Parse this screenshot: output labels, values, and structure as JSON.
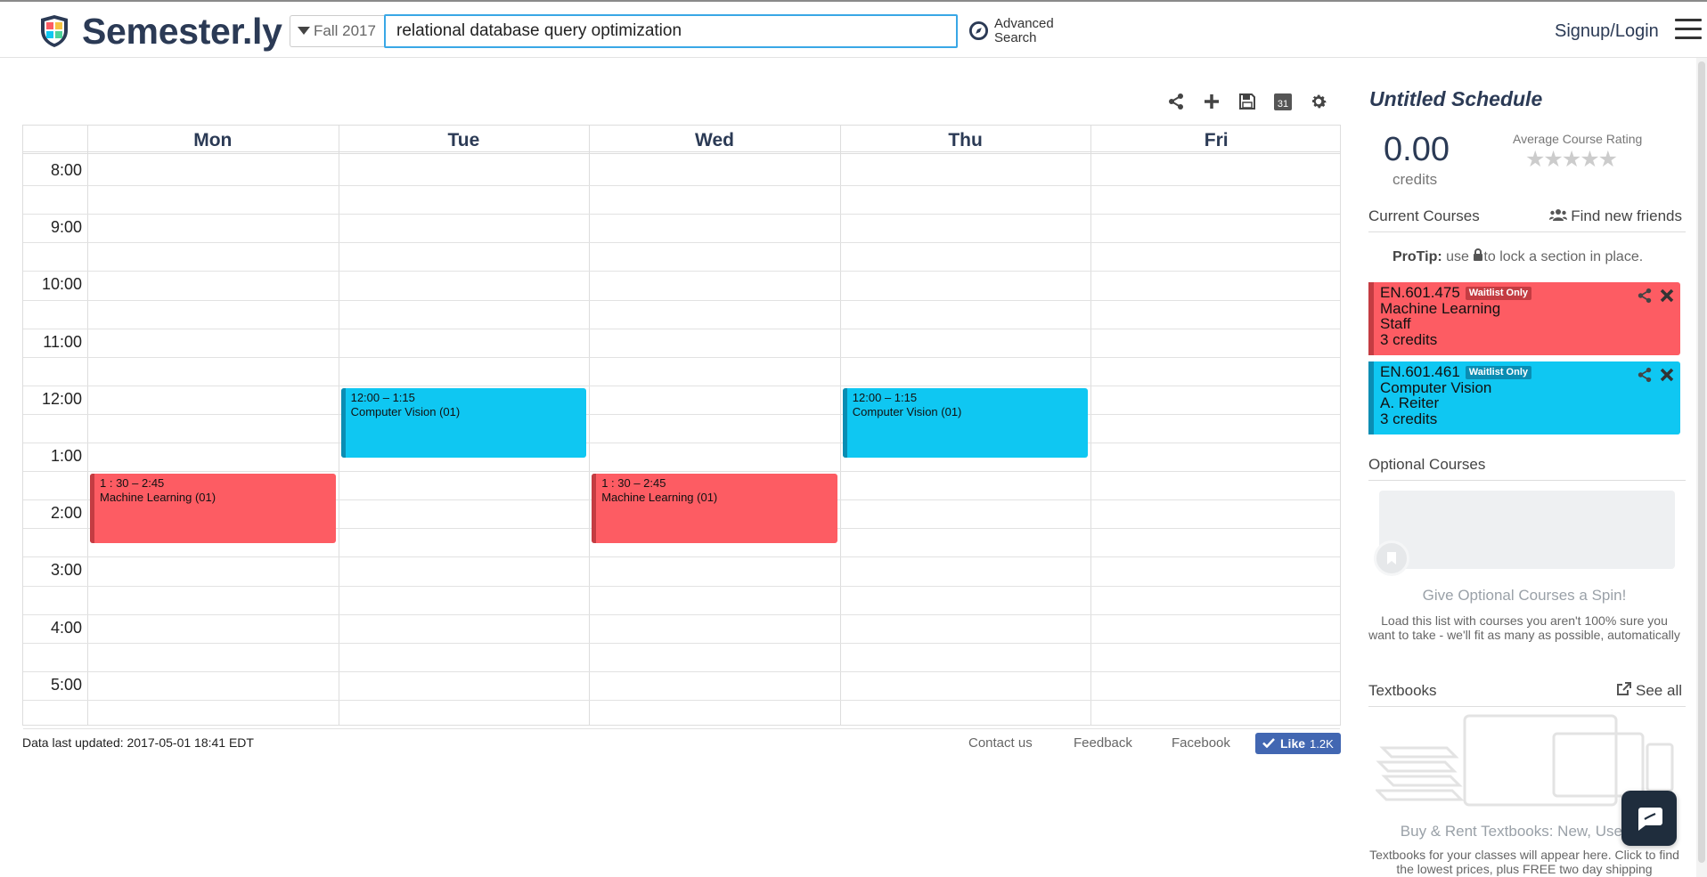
{
  "header": {
    "brand": "Semester.ly",
    "semester": "Fall 2017",
    "search_value": "relational database query optimization",
    "advanced_search_line1": "Advanced",
    "advanced_search_line2": "Search",
    "signup_login": "Signup/Login"
  },
  "toolbar": {
    "icons": [
      "share-icon",
      "plus-icon",
      "save-icon",
      "calendar-icon",
      "gear-icon"
    ],
    "calendar_badge": "31"
  },
  "calendar": {
    "days": [
      "Mon",
      "Tue",
      "Wed",
      "Thu",
      "Fri"
    ],
    "times": [
      "8:00",
      "9:00",
      "10:00",
      "11:00",
      "12:00",
      "1:00",
      "2:00",
      "3:00",
      "4:00",
      "5:00"
    ],
    "events": [
      {
        "day": 0,
        "start": 13.5,
        "end": 14.75,
        "time": "1 : 30 – 2:45",
        "title": "Machine Learning (01)",
        "color": "red"
      },
      {
        "day": 1,
        "start": 12.0,
        "end": 13.25,
        "time": "12:00 – 1:15",
        "title": "Computer Vision (01)",
        "color": "blue"
      },
      {
        "day": 2,
        "start": 13.5,
        "end": 14.75,
        "time": "1 : 30 – 2:45",
        "title": "Machine Learning (01)",
        "color": "red"
      },
      {
        "day": 3,
        "start": 12.0,
        "end": 13.25,
        "time": "12:00 – 1:15",
        "title": "Computer Vision (01)",
        "color": "blue"
      }
    ]
  },
  "footer": {
    "data_updated": "Data last updated: 2017-05-01 18:41 EDT",
    "contact": "Contact us",
    "feedback": "Feedback",
    "facebook": "Facebook",
    "like_label": "Like",
    "like_count": "1.2K"
  },
  "sidebar": {
    "schedule_title": "Untitled Schedule",
    "credits_value": "0.00",
    "credits_label": "credits",
    "avg_rating_label": "Average Course Rating",
    "stars": "★★★★★",
    "current_courses_label": "Current Courses",
    "find_friends_label": "Find new friends",
    "protip_bold": "ProTip:",
    "protip_pre": "use",
    "protip_post": "to lock a section in place.",
    "courses": [
      {
        "code": "EN.601.475",
        "badge": "Waitlist Only",
        "name": "Machine Learning",
        "instructor": "Staff",
        "credits": "3 credits",
        "color": "red"
      },
      {
        "code": "EN.601.461",
        "badge": "Waitlist Only",
        "name": "Computer Vision",
        "instructor": "A. Reiter",
        "credits": "3 credits",
        "color": "blue"
      }
    ],
    "optional_courses_label": "Optional Courses",
    "optional_title": "Give Optional Courses a Spin!",
    "optional_desc": "Load this list with courses you aren't 100% sure you want to take - we'll fit as many as possible, automatically",
    "textbooks_label": "Textbooks",
    "see_all_label": "See all",
    "textbooks_title": "Buy & Rent Textbooks: New, Used or",
    "textbooks_desc": "Textbooks for your classes will appear here. Click to find the lowest prices, plus FREE two day shipping"
  },
  "colors": {
    "brand_navy": "#2b3a55",
    "event_red": "#fd5c63",
    "event_blue": "#0fc7f2",
    "search_border": "#39a7e6"
  }
}
